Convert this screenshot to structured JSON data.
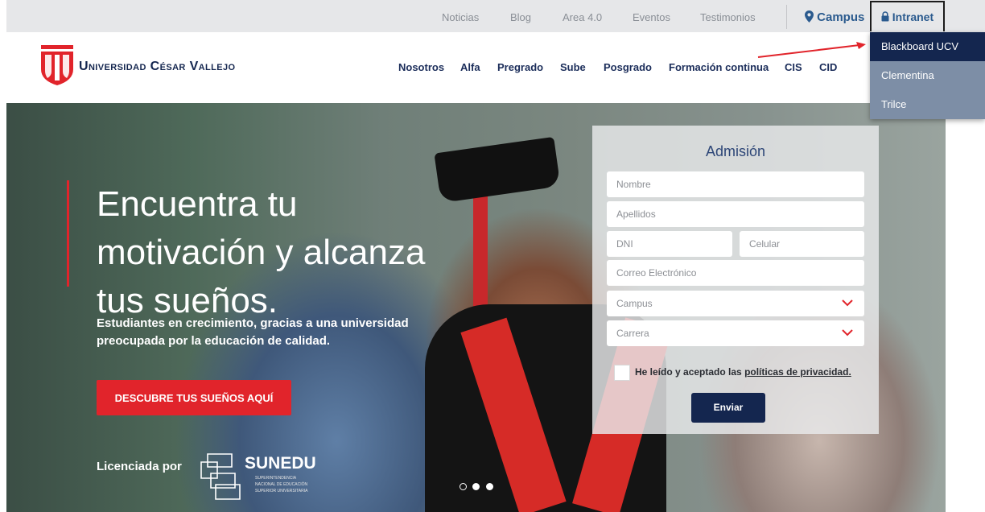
{
  "topbar": {
    "links": [
      "Noticias",
      "Blog",
      "Area 4.0",
      "Eventos",
      "Testimonios"
    ],
    "campus": "Campus",
    "intranet": "Intranet"
  },
  "header": {
    "brand": "Universidad César Vallejo",
    "nav": [
      "Nosotros",
      "Alfa",
      "Pregrado",
      "Sube",
      "Posgrado",
      "Formación continua",
      "CIS",
      "CID"
    ]
  },
  "intranet_menu": {
    "items": [
      "Blackboard UCV",
      "Clementina",
      "Trilce"
    ],
    "highlighted": "Blackboard UCV"
  },
  "hero": {
    "headline": [
      "Encuentra tu",
      "motivación y alcanza",
      "tus sueños."
    ],
    "subline": "Estudiantes en crecimiento, gracias a una universidad preocupada por la educación de calidad.",
    "cta": "DESCUBRE TUS SUEÑOS AQUÍ",
    "licensed_by": "Licenciada por",
    "sunedu": "SUNEDU",
    "sunedu_sub": [
      "SUPERINTENDENCIA",
      "NACIONAL DE EDUCACIÓN",
      "SUPERIOR UNIVERSITARIA"
    ],
    "slides": 3,
    "active_slide": 1
  },
  "form": {
    "title": "Admisión",
    "nombre": "Nombre",
    "apellidos": "Apellidos",
    "dni": "DNI",
    "celular": "Celular",
    "correo": "Correo Electrónico",
    "campus": "Campus",
    "carrera": "Carrera",
    "terms_prefix": "He leído y aceptado las",
    "terms_link": "políticas de privacidad.",
    "submit": "Enviar"
  },
  "colors": {
    "brand_red": "#e1242b",
    "brand_navy": "#14264f",
    "menu_inactive": "#7d8ea6",
    "topbar_bg": "#e6e7e9"
  }
}
